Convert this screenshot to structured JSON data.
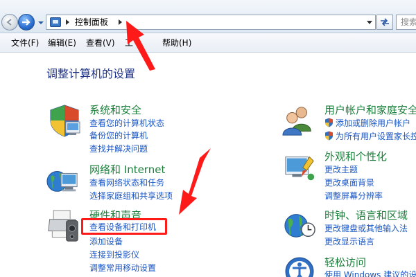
{
  "window": {
    "breadcrumb": "控制面板",
    "search_placeholder": "搜索"
  },
  "menu": [
    {
      "label": "文件(F)"
    },
    {
      "label": "编辑(E)"
    },
    {
      "label": "查看(V)"
    },
    {
      "label": "工"
    },
    {
      "label": "帮助(H)"
    }
  ],
  "page_title": "调整计算机的设置",
  "categories": {
    "security": {
      "title": "系统和安全",
      "links": [
        "查看您的计算机状态",
        "备份您的计算机",
        "查找并解决问题"
      ],
      "icon": "system-security-icon"
    },
    "network": {
      "title": "网络和 Internet",
      "links": [
        "查看网络状态和任务",
        "选择家庭组和共享选项"
      ],
      "icon": "network-icon"
    },
    "hardware": {
      "title": "硬件和声音",
      "links": [
        "查看设备和打印机",
        "添加设备",
        "连接到投影仪",
        "调整常用移动设置"
      ],
      "icon": "printer-icon"
    },
    "users": {
      "title": "用户帐户和家庭安全",
      "links": [
        "添加或删除用户帐户",
        "为所有用户设置家长控"
      ],
      "icon": "users-icon"
    },
    "appearance": {
      "title": "外观和个性化",
      "links": [
        "更改主题",
        "更改桌面背景",
        "调整屏幕分辨率"
      ],
      "icon": "appearance-icon"
    },
    "clock": {
      "title": "时钟、语言和区域",
      "links": [
        "更改键盘或其他输入法",
        "更改显示语言"
      ],
      "icon": "globe-clock-icon"
    },
    "ease": {
      "title": "轻松访问",
      "links": [
        "使用 Windows 建议的设"
      ],
      "icon": "ease-of-access-icon"
    }
  },
  "colors": {
    "category_title": "#1a7f3a",
    "link": "#1a56c3",
    "page_title": "#1e3287",
    "highlight": "#ff1a1a"
  }
}
